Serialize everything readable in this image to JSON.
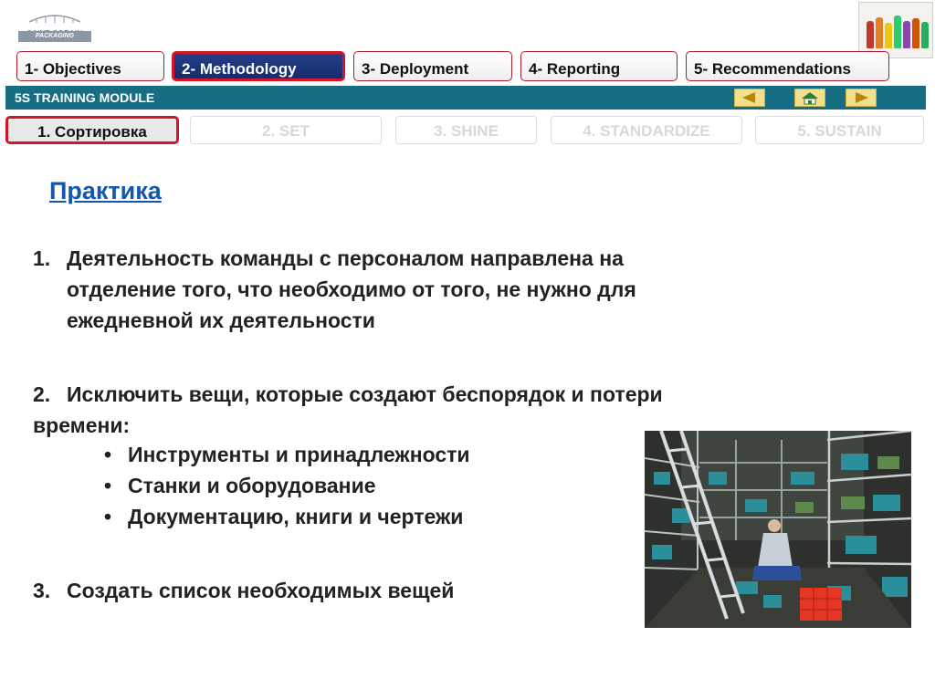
{
  "brand": {
    "name": "SAINT-GOBAIN",
    "division": "PACKAGING"
  },
  "nav": {
    "tabs": [
      {
        "label": "1- Objectives"
      },
      {
        "label": "2- Methodology"
      },
      {
        "label": "3- Deployment"
      },
      {
        "label": "4- Reporting"
      },
      {
        "label": "5- Recommendations"
      }
    ],
    "active_tab": "2- Methodology"
  },
  "module": {
    "title": "5S TRAINING MODULE"
  },
  "steps": [
    {
      "label": "1. Сортировка"
    },
    {
      "label": "2. SET"
    },
    {
      "label": "3. SHINE"
    },
    {
      "label": "4. STANDARDIZE"
    },
    {
      "label": "5. SUSTAIN"
    }
  ],
  "content": {
    "heading": "Практика",
    "item1": {
      "number": "1.",
      "line1": "Деятельность команды с персоналом направлена на",
      "line2": "отделение того, что необходимо от того, не нужно для",
      "line3": "ежедневной их деятельности"
    },
    "item2": {
      "number": "2.",
      "line1": "Исключить вещи, которые создают беспорядок и потери",
      "line2": "времени:",
      "bullets": [
        "Инструменты и принадлежности",
        "Станки и оборудование",
        "Документацию, книги и чертежи"
      ]
    },
    "item3": {
      "number": "3.",
      "line1": "Создать список необходимых вещей"
    }
  },
  "colors": {
    "accent_red": "#d3162c",
    "tab_active": "#1b3478",
    "module_bar": "#176e82",
    "heading": "#1457b0"
  }
}
